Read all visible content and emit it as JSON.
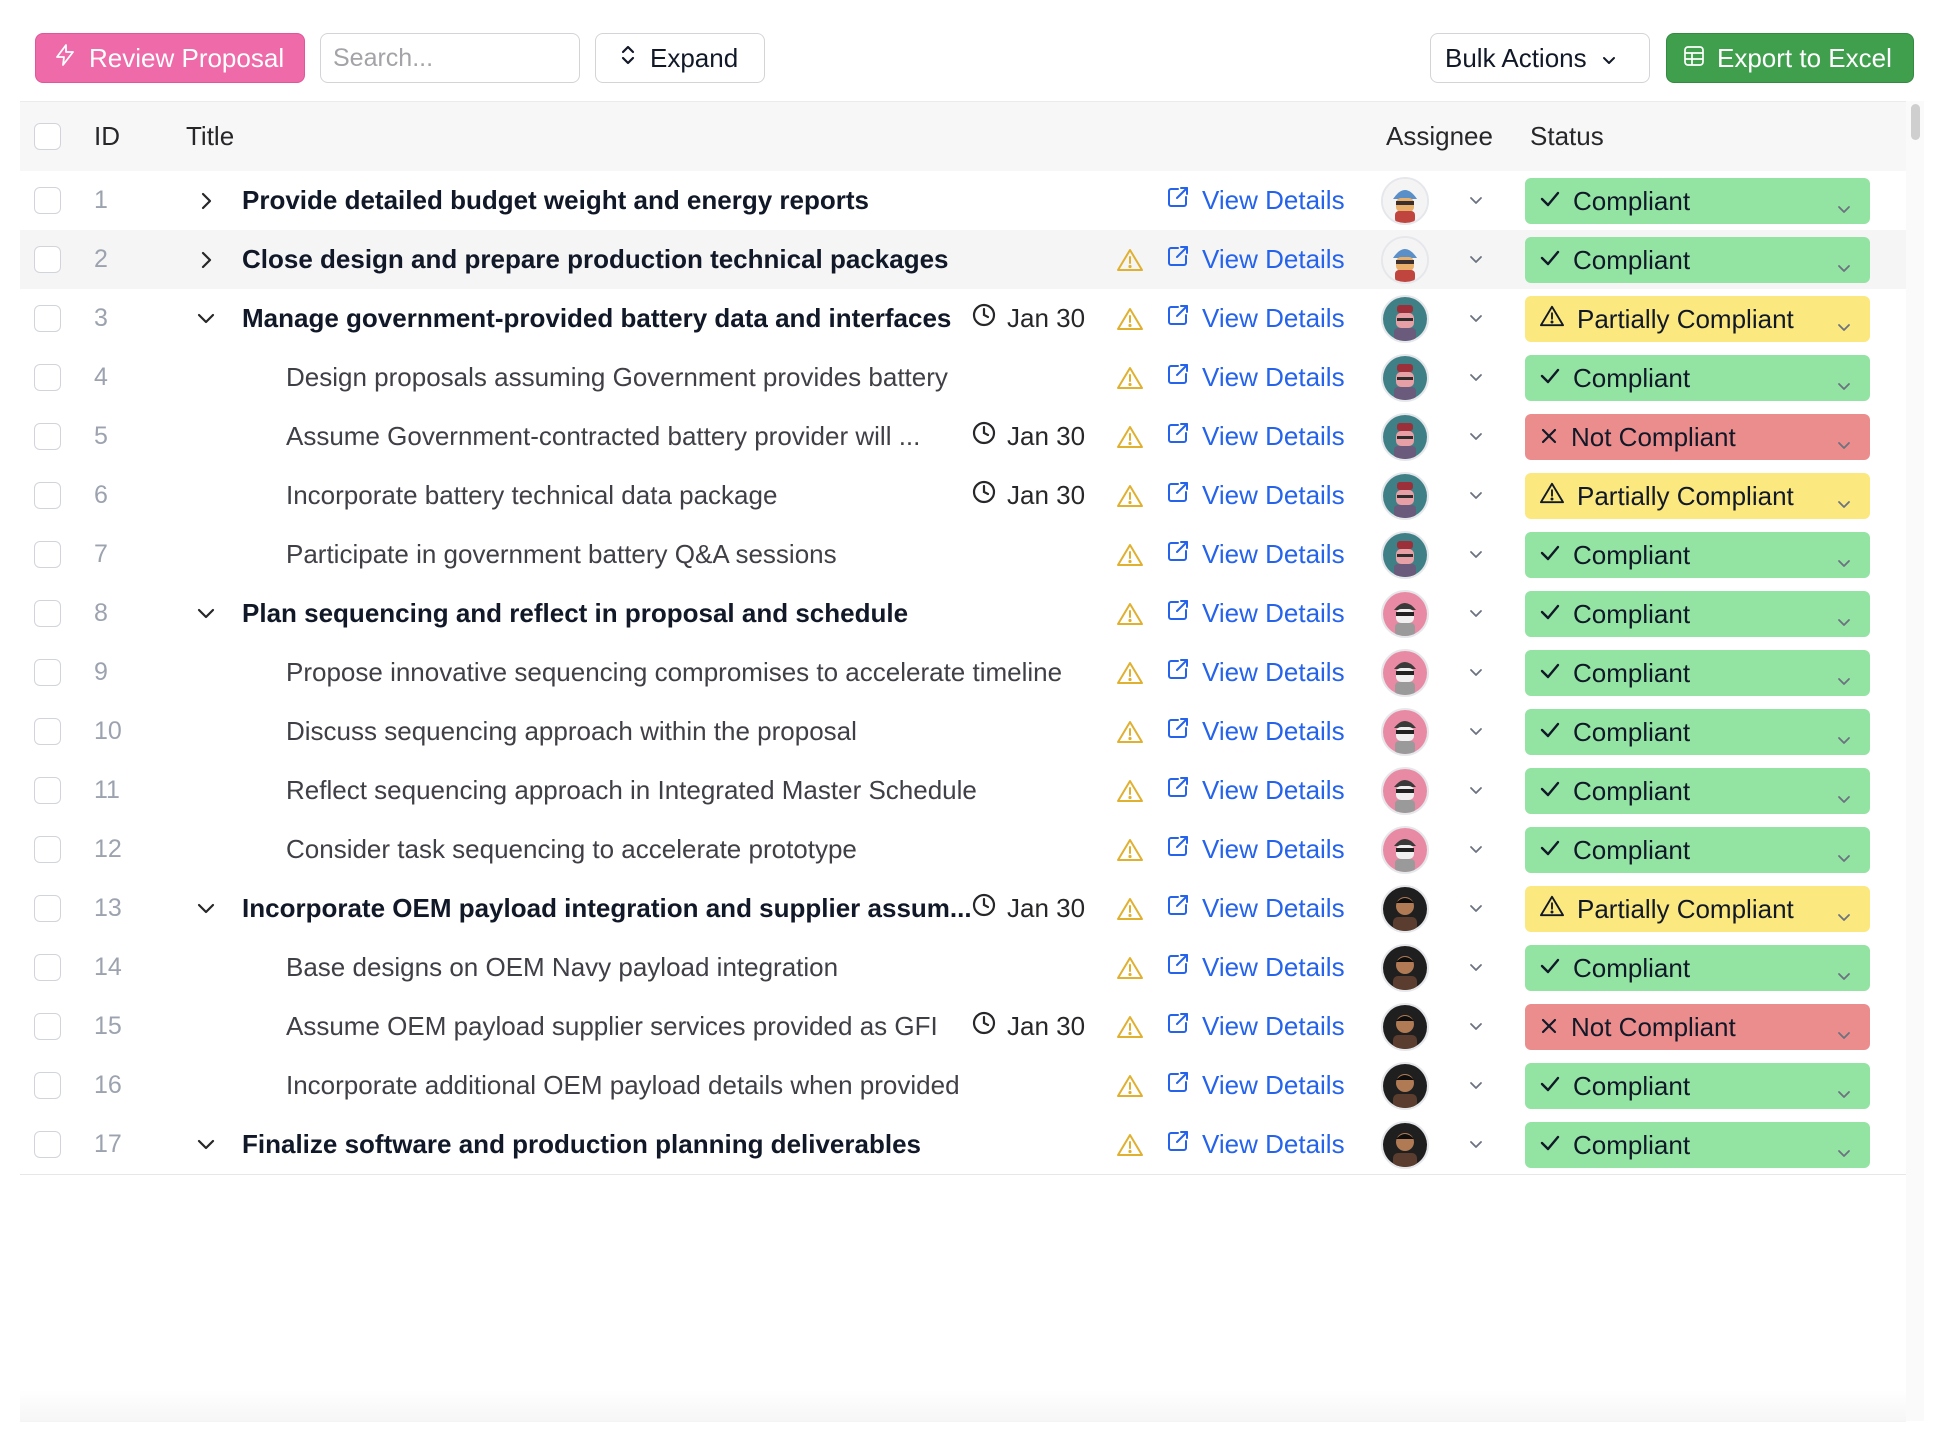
{
  "toolbar": {
    "review_label": "Review Proposal",
    "search_placeholder": "Search...",
    "expand_label": "Expand",
    "bulk_label": "Bulk Actions",
    "export_label": "Export to Excel"
  },
  "table": {
    "headers": {
      "id": "ID",
      "title": "Title",
      "assignee": "Assignee",
      "status": "Status"
    },
    "link_label": "View Details",
    "rows": [
      {
        "id": "1",
        "title": "Provide detailed budget weight and energy reports",
        "level": "parent",
        "toggle": "collapsed",
        "date": "",
        "warning": false,
        "avatar": "avatar-1",
        "status": "Compliant",
        "status_kind": "compliant"
      },
      {
        "id": "2",
        "title": "Close design and prepare production technical packages",
        "level": "parent",
        "toggle": "collapsed",
        "date": "",
        "warning": true,
        "avatar": "avatar-1",
        "status": "Compliant",
        "status_kind": "compliant",
        "highlighted": true
      },
      {
        "id": "3",
        "title": "Manage government-provided battery data and interfaces",
        "level": "parent",
        "toggle": "expanded",
        "date": "Jan 30",
        "warning": true,
        "avatar": "avatar-2",
        "status": "Partially Compliant",
        "status_kind": "partial"
      },
      {
        "id": "4",
        "title": "Design proposals assuming Government provides battery",
        "level": "child",
        "toggle": "",
        "date": "",
        "warning": true,
        "avatar": "avatar-2",
        "status": "Compliant",
        "status_kind": "compliant"
      },
      {
        "id": "5",
        "title": "Assume Government-contracted battery provider will ...",
        "level": "child",
        "toggle": "",
        "date": "Jan 30",
        "warning": true,
        "avatar": "avatar-2",
        "status": "Not Compliant",
        "status_kind": "not"
      },
      {
        "id": "6",
        "title": "Incorporate battery technical data package",
        "level": "child",
        "toggle": "",
        "date": "Jan 30",
        "warning": true,
        "avatar": "avatar-2",
        "status": "Partially Compliant",
        "status_kind": "partial"
      },
      {
        "id": "7",
        "title": "Participate in government battery Q&A sessions",
        "level": "child",
        "toggle": "",
        "date": "",
        "warning": true,
        "avatar": "avatar-2",
        "status": "Compliant",
        "status_kind": "compliant"
      },
      {
        "id": "8",
        "title": "Plan sequencing and reflect in proposal and schedule",
        "level": "parent",
        "toggle": "expanded",
        "date": "",
        "warning": true,
        "avatar": "avatar-3",
        "status": "Compliant",
        "status_kind": "compliant"
      },
      {
        "id": "9",
        "title": "Propose innovative sequencing compromises to accelerate timeline",
        "level": "child",
        "toggle": "",
        "date": "",
        "warning": true,
        "avatar": "avatar-3",
        "status": "Compliant",
        "status_kind": "compliant"
      },
      {
        "id": "10",
        "title": "Discuss sequencing approach within the proposal",
        "level": "child",
        "toggle": "",
        "date": "",
        "warning": true,
        "avatar": "avatar-3",
        "status": "Compliant",
        "status_kind": "compliant"
      },
      {
        "id": "11",
        "title": "Reflect sequencing approach in Integrated Master Schedule",
        "level": "child",
        "toggle": "",
        "date": "",
        "warning": true,
        "avatar": "avatar-3",
        "status": "Compliant",
        "status_kind": "compliant"
      },
      {
        "id": "12",
        "title": "Consider task sequencing to accelerate prototype",
        "level": "child",
        "toggle": "",
        "date": "",
        "warning": true,
        "avatar": "avatar-3",
        "status": "Compliant",
        "status_kind": "compliant"
      },
      {
        "id": "13",
        "title": "Incorporate OEM payload integration and supplier assum...",
        "level": "parent",
        "toggle": "expanded",
        "date": "Jan 30",
        "warning": true,
        "avatar": "avatar-4",
        "status": "Partially Compliant",
        "status_kind": "partial"
      },
      {
        "id": "14",
        "title": "Base designs on OEM Navy payload integration",
        "level": "child",
        "toggle": "",
        "date": "",
        "warning": true,
        "avatar": "avatar-4",
        "status": "Compliant",
        "status_kind": "compliant"
      },
      {
        "id": "15",
        "title": "Assume OEM payload supplier services provided as GFI",
        "level": "child",
        "toggle": "",
        "date": "Jan 30",
        "warning": true,
        "avatar": "avatar-4",
        "status": "Not Compliant",
        "status_kind": "not"
      },
      {
        "id": "16",
        "title": "Incorporate additional OEM payload details when provided",
        "level": "child",
        "toggle": "",
        "date": "",
        "warning": true,
        "avatar": "avatar-4",
        "status": "Compliant",
        "status_kind": "compliant"
      },
      {
        "id": "17",
        "title": "Finalize software and production planning deliverables",
        "level": "parent",
        "toggle": "expanded",
        "date": "",
        "warning": true,
        "avatar": "avatar-4",
        "status": "Compliant",
        "status_kind": "compliant"
      }
    ]
  },
  "colors": {
    "review_button": "#ee6aa8",
    "export_button": "#3f9f4d",
    "link": "#2563eb",
    "warning": "#e0b030",
    "compliant": "#93e3a2",
    "partially_compliant": "#fbe87e",
    "not_compliant": "#ec8d8d"
  },
  "icons": {
    "review": "lightning-icon",
    "expand": "expand-vertical-icon",
    "bulk": "chevron-down-icon",
    "export": "spreadsheet-icon",
    "collapsed": "chevron-right-icon",
    "expanded": "chevron-down-icon",
    "date": "clock-icon",
    "warning": "warning-triangle-icon",
    "link": "external-link-icon",
    "compliant": "check-icon",
    "partial": "warning-triangle-icon",
    "not": "x-icon"
  }
}
